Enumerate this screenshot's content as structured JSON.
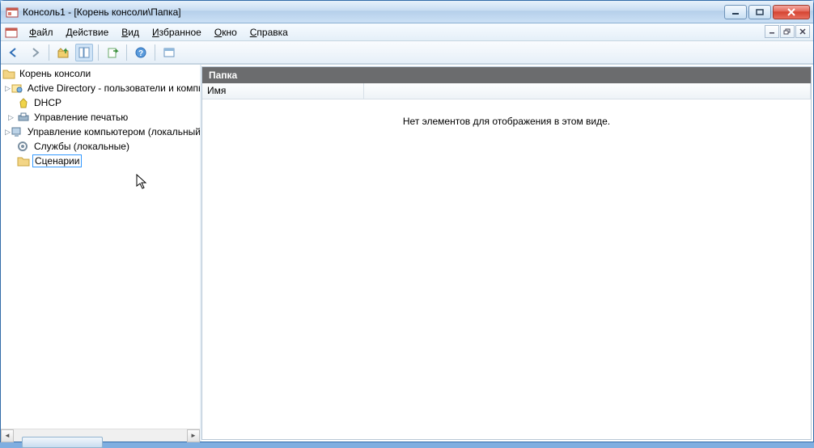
{
  "titlebar": {
    "title": "Консоль1 - [Корень консоли\\Папка]"
  },
  "menu": {
    "file": "Файл",
    "action": "Действие",
    "view": "Вид",
    "favorites": "Избранное",
    "window": "Окно",
    "help": "Справка"
  },
  "tree": {
    "root": "Корень консоли",
    "items": [
      {
        "label": "Active Directory - пользователи и компьютеры",
        "expandable": true
      },
      {
        "label": "DHCP",
        "expandable": false
      },
      {
        "label": "Управление печатью",
        "expandable": true
      },
      {
        "label": "Управление компьютером (локальный)",
        "expandable": true
      },
      {
        "label": "Службы (локальные)",
        "expandable": false
      },
      {
        "label": "Сценарии",
        "editing": true,
        "expandable": false
      }
    ]
  },
  "right": {
    "header": "Папка",
    "column": "Имя",
    "empty": "Нет элементов для отображения в этом виде."
  }
}
